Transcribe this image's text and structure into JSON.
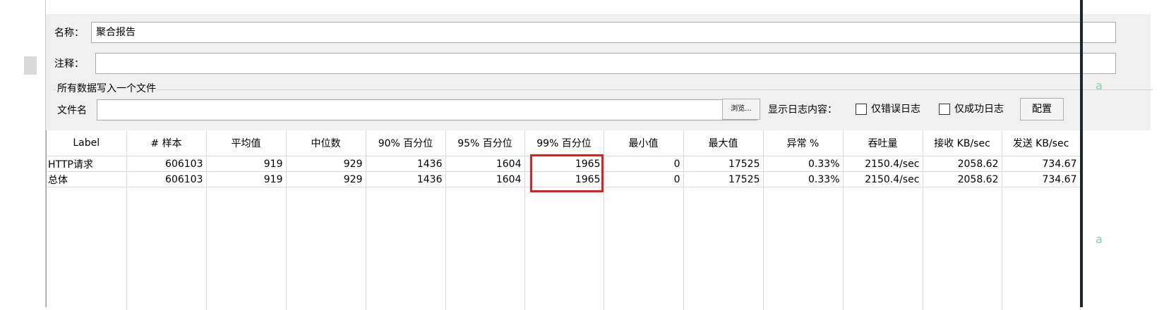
{
  "form": {
    "name_label": "名称：",
    "name_value": "聚合报告",
    "comment_label": "注释：",
    "comment_value": "",
    "group_title": "所有数据写入一个文件",
    "filename_label": "文件名",
    "filename_value": "",
    "browse_label": "浏览...",
    "show_log_label": "显示日志内容：",
    "errors_only_label": "仅错误日志",
    "success_only_label": "仅成功日志",
    "config_label": "配置"
  },
  "table": {
    "columns": [
      "Label",
      "# 样本",
      "平均值",
      "中位数",
      "90% 百分位",
      "95% 百分位",
      "99% 百分位",
      "最小值",
      "最大值",
      "异常 %",
      "吞吐量",
      "接收 KB/sec",
      "发送 KB/sec"
    ],
    "rows": [
      [
        "HTTP请求",
        "606103",
        "919",
        "929",
        "1436",
        "1604",
        "1965",
        "0",
        "17525",
        "0.33%",
        "2150.4/sec",
        "2058.62",
        "734.67"
      ],
      [
        "总体",
        "606103",
        "919",
        "929",
        "1436",
        "1604",
        "1965",
        "0",
        "17525",
        "0.33%",
        "2150.4/sec",
        "2058.62",
        "734.67"
      ]
    ]
  },
  "edge_glyph": "a",
  "colors": {
    "highlight": "#e02020",
    "panel_bg": "#f0f0f0"
  }
}
